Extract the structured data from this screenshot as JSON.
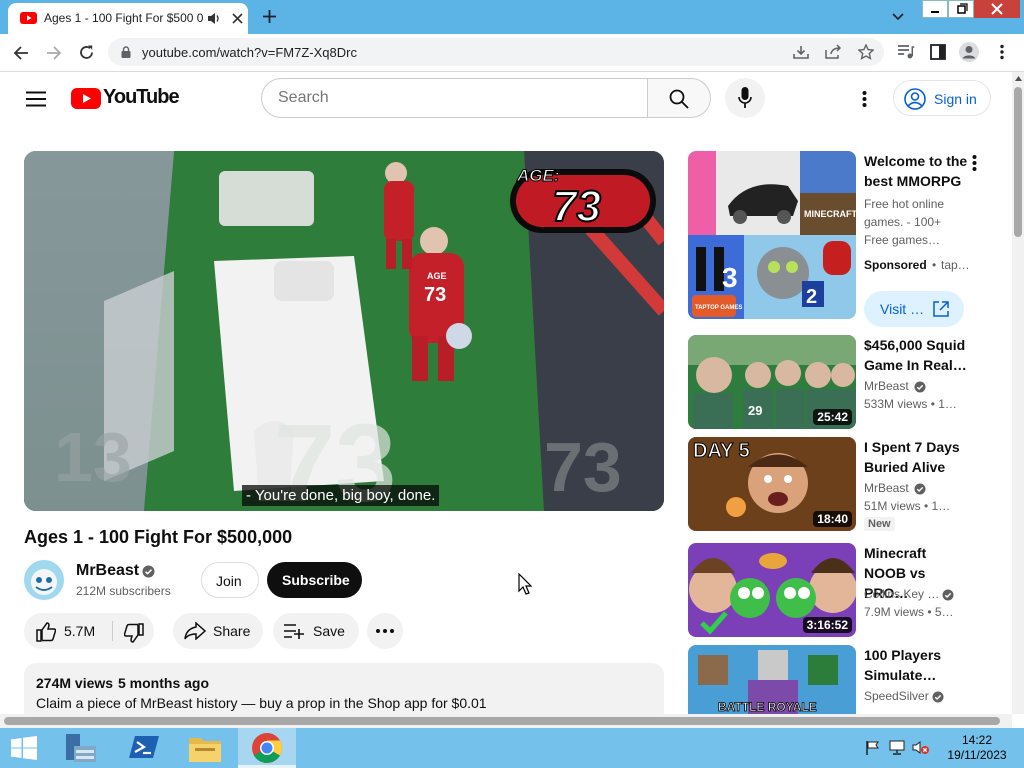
{
  "browser": {
    "tab_title": "Ages 1 - 100 Fight For $500 0",
    "url": "youtube.com/watch?v=FM7Z-Xq8Drc"
  },
  "header": {
    "logo_text": "YouTube",
    "search_placeholder": "Search",
    "sign_in": "Sign in"
  },
  "player": {
    "caption": "- You're done, big boy, done.",
    "age_badge_label": "AGE:",
    "age_badge_value": "73",
    "shirt_label": "AGE",
    "shirt_number": "73"
  },
  "video": {
    "title": "Ages 1 - 100 Fight For $500,000",
    "channel": "MrBeast",
    "subscribers": "212M subscribers",
    "join": "Join",
    "subscribe": "Subscribe",
    "likes": "5.7M",
    "share": "Share",
    "save": "Save",
    "views": "274M views",
    "age": "5 months ago",
    "description": "Claim a piece of MrBeast history — buy a prop in the Shop app for $0.01"
  },
  "related": [
    {
      "title": "Welcome to the best MMORPG",
      "description": "Free hot online games. - 100+ Free games…",
      "sponsored": "Sponsored",
      "advertiser": "tap…",
      "cta": "Visit …",
      "thumb_labels": [
        "TAPTOP GAMES",
        "MINECRAFT"
      ]
    },
    {
      "title": "$456,000 Squid Game In Real…",
      "channel": "MrBeast",
      "meta": "533M views • 1…",
      "duration": "25:42"
    },
    {
      "title": "I Spent 7 Days Buried Alive",
      "channel": "MrBeast",
      "meta": "51M views • 1…",
      "badge": "New",
      "duration": "18:40",
      "thumb_text": "DAY 5"
    },
    {
      "title": "Minecraft NOOB vs PRO…",
      "channel": "Collins Key …",
      "meta": "7.9M views • 5…",
      "duration": "3:16:52"
    },
    {
      "title": "100 Players Simulate…",
      "channel": "SpeedSilver",
      "thumb_text": "BATTLE ROYALE"
    }
  ],
  "taskbar": {
    "time": "14:22",
    "date": "19/11/2023"
  },
  "colors": {
    "youtube_red": "#ff0000",
    "link_blue": "#065fd4",
    "chrome_tabstrip": "#5cb3e6",
    "taskbar": "#74c1ec"
  }
}
